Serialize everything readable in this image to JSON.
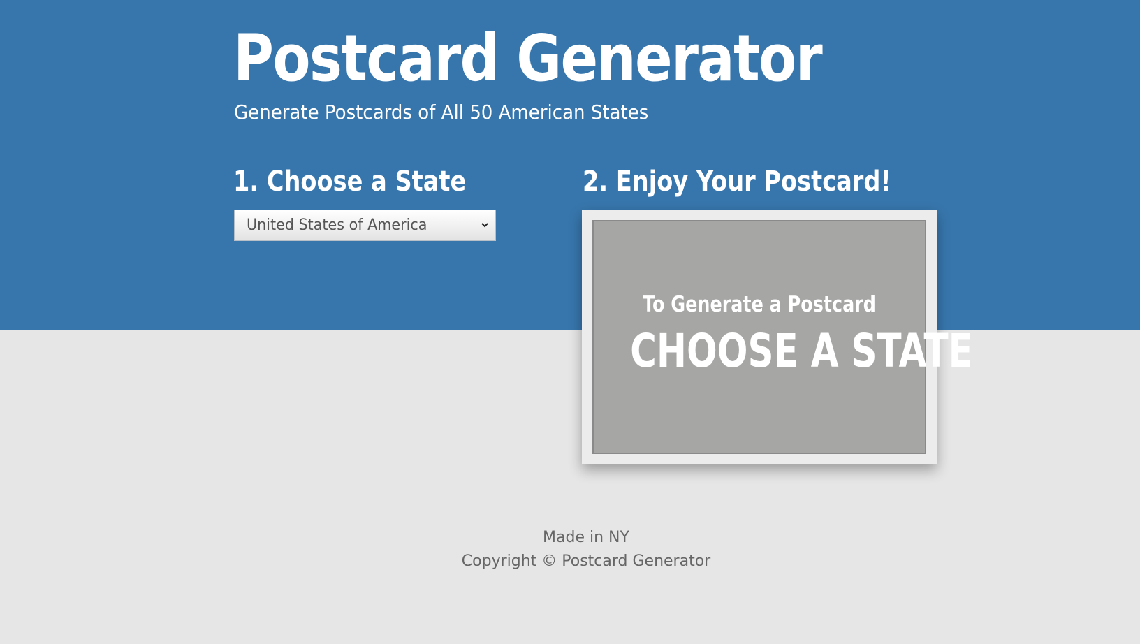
{
  "header": {
    "title": "Postcard Generator",
    "subtitle": "Generate Postcards of All 50 American States"
  },
  "steps": {
    "choose_heading": "1. Choose a State",
    "enjoy_heading": "2. Enjoy Your Postcard!"
  },
  "state_select": {
    "selected": "United States of America",
    "icon": "chevron-down-icon"
  },
  "postcard": {
    "line1": "To Generate a Postcard",
    "line2": "CHOOSE A STATE"
  },
  "footer": {
    "made_in": "Made in NY",
    "copyright": "Copyright © Postcard Generator"
  },
  "colors": {
    "hero_blue": "#3776ac",
    "page_background": "#e6e6e6",
    "postcard_gray": "#a6a6a5"
  }
}
